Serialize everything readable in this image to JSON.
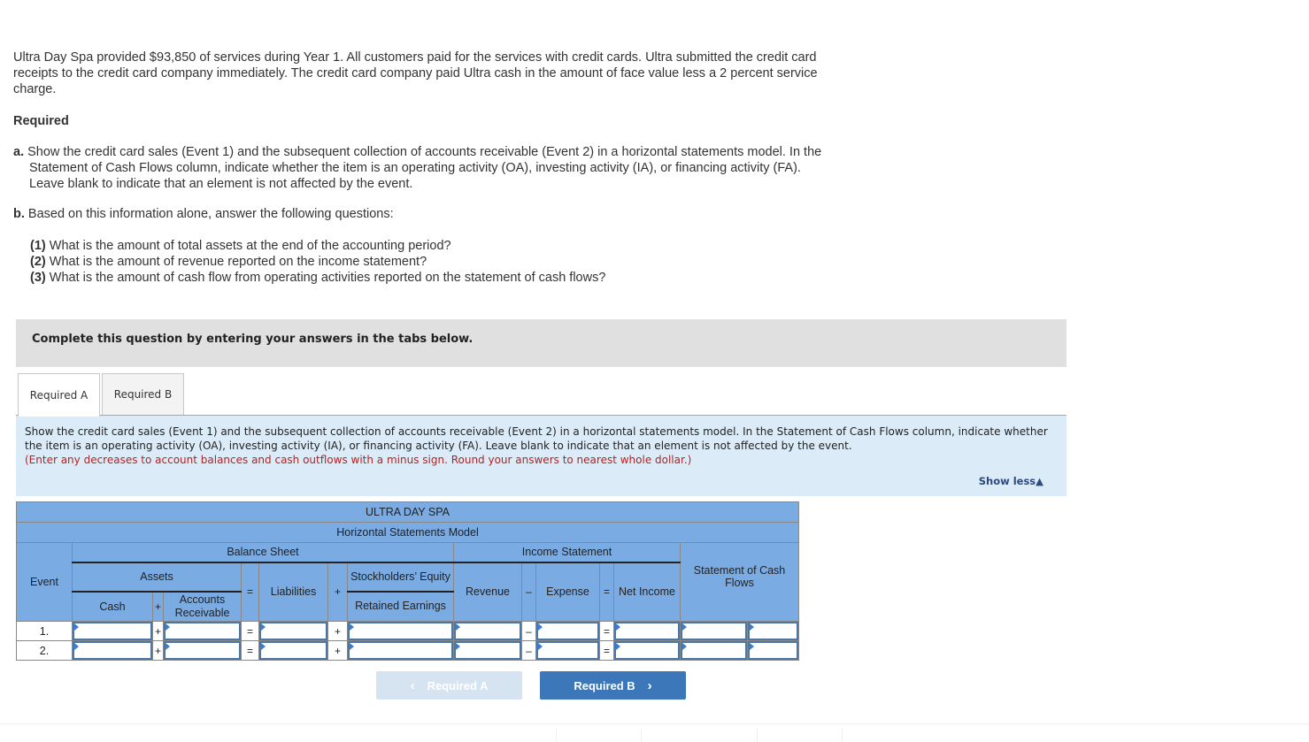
{
  "problem": {
    "intro": "Ultra Day Spa provided $93,850 of services during Year 1. All customers paid for the services with credit cards. Ultra submitted the credit card receipts to the credit card company immediately. The credit card company paid Ultra cash in the amount of face value less a 2 percent service charge.",
    "required_heading": "Required",
    "part_a_label": "a.",
    "part_a_text": " Show the credit card sales (Event 1) and the subsequent collection of accounts receivable (Event 2) in a horizontal statements model. In the Statement of Cash Flows column, indicate whether the item is an operating activity (OA), investing activity (IA), or financing activity (FA). Leave blank to indicate that an element is not affected by the event.",
    "part_b_label": "b.",
    "part_b_text": " Based on this information alone, answer the following questions:",
    "questions": [
      {
        "num": "(1)",
        "text": " What is the amount of total assets at the end of the accounting period?"
      },
      {
        "num": "(2)",
        "text": " What is the amount of revenue reported on the income statement?"
      },
      {
        "num": "(3)",
        "text": " What is the amount of cash flow from operating activities reported on the statement of cash flows?"
      }
    ]
  },
  "banner": {
    "text": "Complete this question by entering your answers in the tabs below."
  },
  "tabs": [
    {
      "label": "Required A",
      "active": true
    },
    {
      "label": "Required B",
      "active": false
    }
  ],
  "instructions": {
    "text": "Show the credit card sales (Event 1) and the subsequent collection of accounts receivable (Event 2) in a horizontal statements model. In the Statement of Cash Flows column, indicate whether the item is an operating activity (OA), investing activity (IA), or financing activity (FA). Leave blank to indicate that an element is not affected by the event.",
    "note": "(Enter any decreases to account balances and cash outflows with a minus sign. Round your answers to nearest whole dollar.)",
    "show_less": "Show less▲"
  },
  "table": {
    "company": "ULTRA DAY SPA",
    "model_title": "Horizontal Statements Model",
    "balance_sheet": "Balance Sheet",
    "income_statement": "Income Statement",
    "event_header": "Event",
    "assets": "Assets",
    "cash": "Cash",
    "plus": "+",
    "equals": "=",
    "minus": "–",
    "accounts_receivable": "Accounts Receivable",
    "liabilities": "Liabilities",
    "stockholders_equity": "Stockholders’ Equity",
    "retained_earnings": "Retained Earnings",
    "revenue": "Revenue",
    "expense": "Expense",
    "net_income": "Net Income",
    "cash_flows": "Statement of Cash Flows",
    "rows": [
      {
        "event": "1.",
        "cash": "",
        "ar": "",
        "liabilities": "",
        "re": "",
        "revenue": "",
        "expense": "",
        "net_income": "",
        "cf_amount": "",
        "cf_activity": ""
      },
      {
        "event": "2.",
        "cash": "",
        "ar": "",
        "liabilities": "",
        "re": "",
        "revenue": "",
        "expense": "",
        "net_income": "",
        "cf_amount": "",
        "cf_activity": ""
      }
    ]
  },
  "navigation": {
    "prev_label": "Required A",
    "next_label": "Required B",
    "prev_icon": "‹",
    "next_icon": "›"
  },
  "colors": {
    "table_header": "#7aabe3",
    "instructions_bg": "#dbecf8",
    "banner_bg": "#e0e0e0",
    "next_button": "#3c78b9",
    "prev_button_disabled": "#d6e3f1",
    "note_red": "#b22222"
  }
}
